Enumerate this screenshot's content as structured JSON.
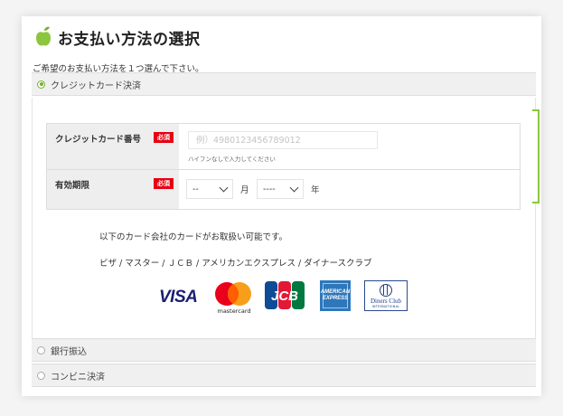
{
  "page_title": "お支払い方法の選択",
  "instruction": "ご希望のお支払い方法を１つ選んで下さい。",
  "methods": [
    {
      "label": "クレジットカード決済",
      "selected": true
    },
    {
      "label": "銀行振込",
      "selected": false
    },
    {
      "label": "コンビニ決済",
      "selected": false
    }
  ],
  "credit_form": {
    "card_number": {
      "label": "クレジットカード番号",
      "required_badge": "必須",
      "placeholder": "例）4980123456789012",
      "value": "",
      "hint": "ハイフンなしで入力してください"
    },
    "expiry": {
      "label": "有効期限",
      "required_badge": "必須",
      "month_value": "--",
      "month_unit": "月",
      "year_value": "----",
      "year_unit": "年"
    }
  },
  "accepted_cards_note": "以下のカード会社のカードがお取扱い可能です。",
  "accepted_cards_list": "ビザ / マスター / ＪＣＢ / アメリカンエクスプレス / ダイナースクラブ",
  "brands": {
    "visa": "VISA",
    "mastercard": "mastercard",
    "jcb": "JCB",
    "amex_line1": "AMERICAN",
    "amex_line2": "EXPRESS",
    "diners": "Diners Club",
    "diners_sub": "INTERNATIONAL"
  },
  "colors": {
    "accent": "#8cc63f",
    "required": "#e60012",
    "header_bg": "#f0f0f0",
    "label_bg": "#eeeeee"
  }
}
